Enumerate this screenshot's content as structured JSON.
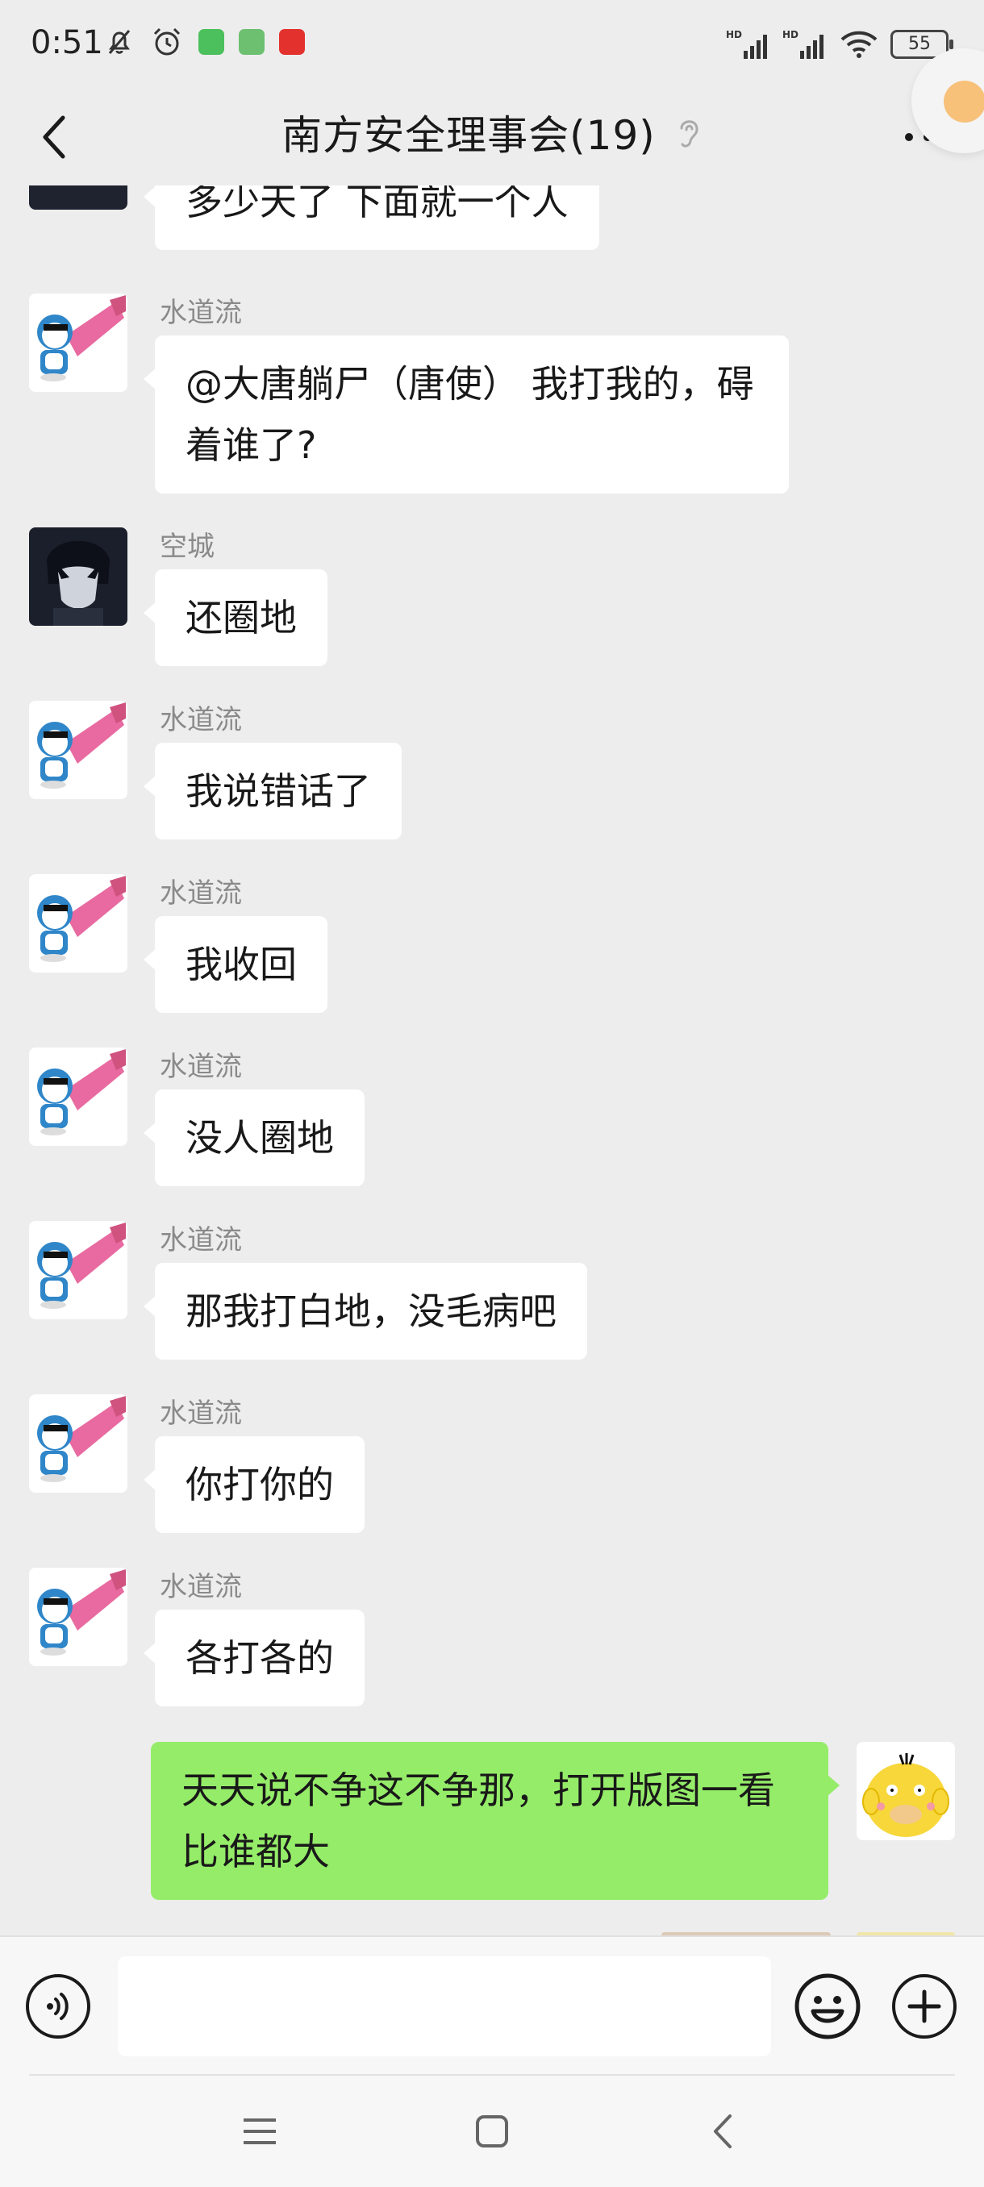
{
  "status_bar": {
    "time": "0:51",
    "battery": "55",
    "signal_label": "HD"
  },
  "header": {
    "title": "南方安全理事会(19)"
  },
  "messages": [
    {
      "sender": "",
      "text": "多少天了 下面就一个人",
      "avatar": "dark-anime-avatar"
    },
    {
      "sender": "水道流",
      "text": "@大唐躺尸（唐使）  我打我的，碍着谁了?",
      "avatar": "doraemon-avatar"
    },
    {
      "sender": "空城",
      "text": "还圈地",
      "avatar": "dark-anime-avatar"
    },
    {
      "sender": "水道流",
      "text": "我说错话了",
      "avatar": "doraemon-avatar"
    },
    {
      "sender": "水道流",
      "text": "我收回",
      "avatar": "doraemon-avatar"
    },
    {
      "sender": "水道流",
      "text": "没人圈地",
      "avatar": "doraemon-avatar"
    },
    {
      "sender": "水道流",
      "text": "那我打白地，没毛病吧",
      "avatar": "doraemon-avatar"
    },
    {
      "sender": "水道流",
      "text": "你打你的",
      "avatar": "doraemon-avatar"
    },
    {
      "sender": "水道流",
      "text": "各打各的",
      "avatar": "doraemon-avatar"
    },
    {
      "sender": "",
      "text": "天天说不争这不争那，打开版图一看比谁都大",
      "avatar": "psyduck-avatar",
      "mine": true
    }
  ],
  "input": {
    "value": "",
    "placeholder": ""
  },
  "colors": {
    "background": "#ededed",
    "my_bubble": "#95ec69",
    "other_bubble": "#ffffff"
  }
}
